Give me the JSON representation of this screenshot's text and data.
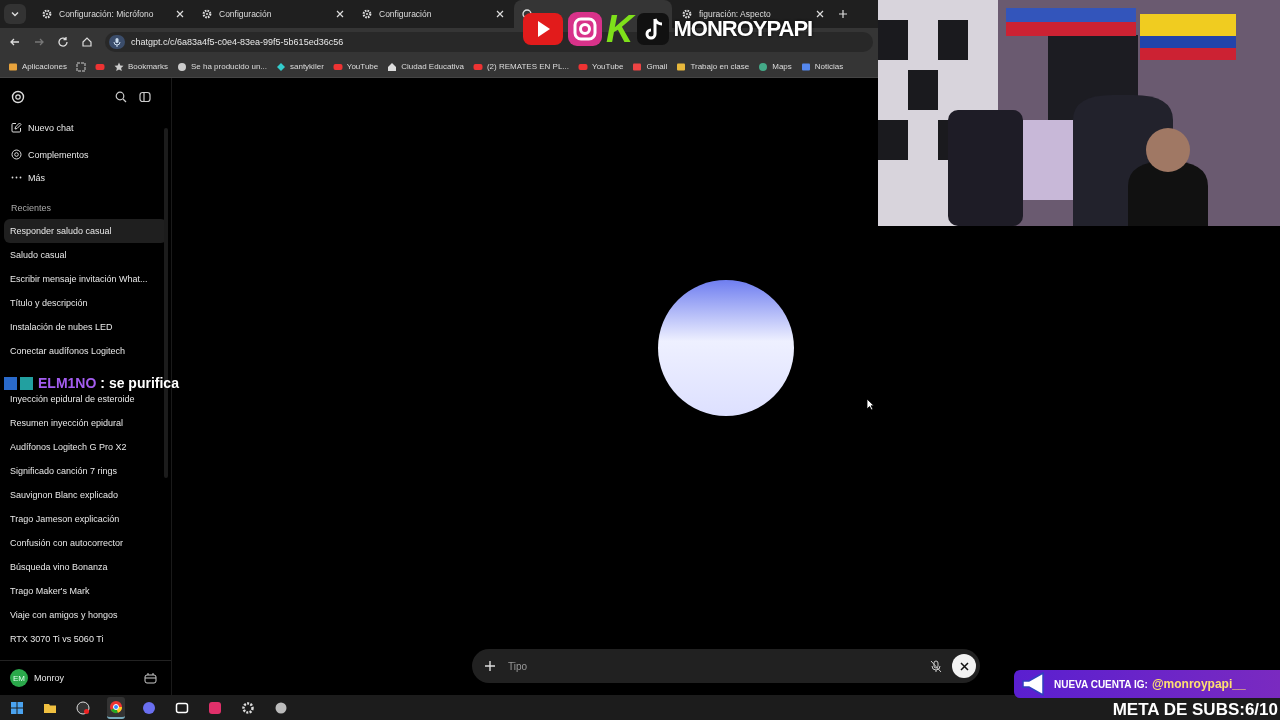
{
  "tabs": [
    {
      "label": "Configuración: Micrófono",
      "kind": "settings",
      "selected": false
    },
    {
      "label": "Configuración",
      "kind": "settings",
      "selected": false
    },
    {
      "label": "Configuración",
      "kind": "settings",
      "selected": false
    },
    {
      "kind": "chat",
      "selected": true
    },
    {
      "label": "figuración: Aspecto",
      "kind": "settings",
      "selected": false
    }
  ],
  "address_bar": {
    "url": "chatgpt.c/c/6a83a4f5-c0e4-83ea-99f5-5b615ed36c56"
  },
  "bookmarks": [
    {
      "label": "Aplicaciones",
      "kind": "apps"
    },
    {
      "kind": "grid"
    },
    {
      "kind": "video"
    },
    {
      "label": "Bookmarks",
      "kind": "star"
    },
    {
      "label": "Se ha producido un...",
      "kind": "globe"
    },
    {
      "label": "santykiler",
      "kind": "diamond"
    },
    {
      "label": "YouTube",
      "kind": "video"
    },
    {
      "label": "Ciudad Educativa",
      "kind": "house"
    },
    {
      "label": "(2) REMATES EN PL...",
      "kind": "video"
    },
    {
      "label": "YouTube",
      "kind": "video"
    },
    {
      "label": "Gmail",
      "kind": "mail"
    },
    {
      "label": "Trabajo en clase",
      "kind": "board"
    },
    {
      "label": "Maps",
      "kind": "pin"
    },
    {
      "label": "Noticias",
      "kind": "news"
    }
  ],
  "sidebar": {
    "actions": [
      {
        "label": "Nuevo chat",
        "kind": "edit"
      },
      {
        "label": "Complementos",
        "kind": "at"
      },
      {
        "label": "Más",
        "kind": "more"
      }
    ],
    "recent_heading": "Recientes",
    "recent": [
      {
        "label": "Responder saludo casual",
        "selected": true
      },
      {
        "label": "Saludo casual",
        "selected": false
      },
      {
        "label": "Escribir mensaje invitación What...",
        "selected": false
      },
      {
        "label": "Título y descripción",
        "selected": false
      },
      {
        "label": "Instalación de nubes LED",
        "selected": false
      },
      {
        "label": "Conectar audífonos Logitech",
        "selected": false
      },
      {
        "label": "Inyección epidural de esteroide",
        "selected": false
      },
      {
        "label": "Resumen inyección epidural",
        "selected": false
      },
      {
        "label": "Audífonos Logitech G Pro X2",
        "selected": false
      },
      {
        "label": "Significado canción 7 rings",
        "selected": false
      },
      {
        "label": "Sauvignon Blanc explicado",
        "selected": false
      },
      {
        "label": "Trago Jameson explicación",
        "selected": false
      },
      {
        "label": "Confusión con autocorrector",
        "selected": false
      },
      {
        "label": "Búsqueda vino Bonanza",
        "selected": false
      },
      {
        "label": "Trago Maker's Mark",
        "selected": false
      },
      {
        "label": "Viaje con amigos y hongos",
        "selected": false
      },
      {
        "label": "RTX 3070 Ti vs 5060 Ti",
        "selected": false
      }
    ],
    "user": {
      "initials": "EM",
      "name": "Monroy"
    }
  },
  "composer": {
    "placeholder": "Tipo"
  },
  "stream_overlay": {
    "logo_letter": "K",
    "logo_text": "MONROYPAPI",
    "chat_user": "ELM1NO",
    "chat_message": ": se purifica",
    "banner": "NUEVA CUENTA IG:",
    "banner_handle": "@monroypapi__",
    "goal": "META DE SUBS:6/10"
  },
  "taskbar": [
    {
      "kind": "start",
      "active": false
    },
    {
      "kind": "folder",
      "active": false
    },
    {
      "kind": "record",
      "active": false
    },
    {
      "kind": "browser",
      "active": true
    },
    {
      "kind": "chat",
      "active": false
    },
    {
      "kind": "editor",
      "active": false
    },
    {
      "kind": "video",
      "active": false
    },
    {
      "kind": "settings",
      "active": false
    },
    {
      "kind": "app",
      "active": false
    }
  ]
}
